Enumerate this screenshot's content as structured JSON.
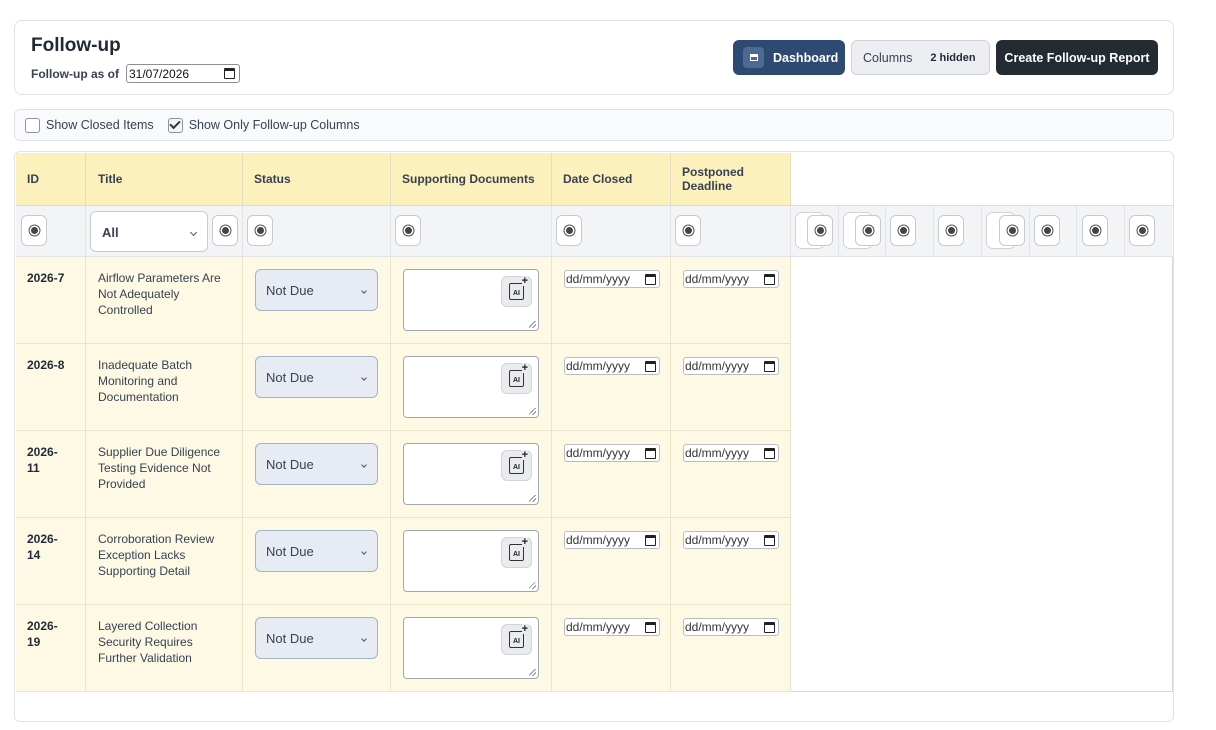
{
  "header": {
    "title": "Follow-up",
    "as_of_label": "Follow-up as of",
    "as_of_value": "31/07/2026",
    "dashboard_label": "Dashboard",
    "columns_label": "Columns",
    "columns_badge": "2 hidden",
    "create_label": "Create Follow-up Report"
  },
  "filters": {
    "show_closed_label": "Show Closed Items",
    "show_closed_checked": false,
    "show_followup_cols_label": "Show Only Follow-up Columns",
    "show_followup_cols_checked": true
  },
  "table": {
    "columns": [
      "ID",
      "Title",
      "Status",
      "Supporting Documents",
      "Date Closed",
      "Postponed Deadline"
    ],
    "title_filter_value": "All",
    "date_placeholder": "dd/mm/yyyy",
    "rows": [
      {
        "id": "2026-7",
        "title": "Airflow Parameters Are Not Adequately Controlled",
        "status": "Not Due"
      },
      {
        "id": "2026-8",
        "title": "Inadequate Batch Monitoring and Documentation",
        "status": "Not Due"
      },
      {
        "id": "2026-11",
        "title": "Supplier Due Diligence Testing Evidence Not Provided",
        "status": "Not Due"
      },
      {
        "id": "2026-14",
        "title": "Corroboration Review Exception Lacks Supporting Detail",
        "status": "Not Due"
      },
      {
        "id": "2026-19",
        "title": "Layered Collection Security Requires Further Validation",
        "status": "Not Due"
      }
    ]
  },
  "colors": {
    "header_bg": "#fcf1bd",
    "row_bg": "#fdf9e5",
    "dashboard_btn": "#2f4a72",
    "create_btn": "#242b33",
    "status_bg": "#e7ecf4"
  },
  "icons": {
    "dashboard": "dashboard-icon",
    "calendar": "calendar-icon",
    "visibility": "eye-toggle-icon",
    "ai_upload": "ai-document-icon"
  }
}
